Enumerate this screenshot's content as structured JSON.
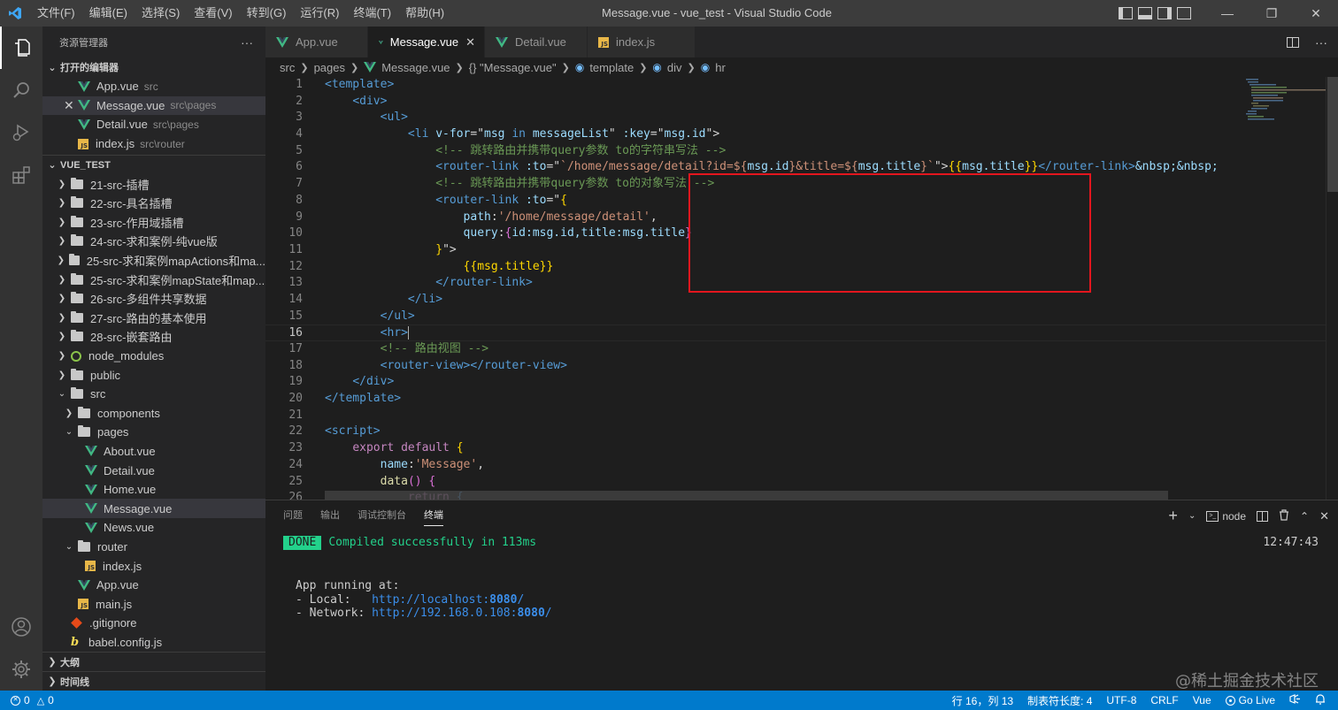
{
  "titlebar": {
    "menu": [
      "文件(F)",
      "编辑(E)",
      "选择(S)",
      "查看(V)",
      "转到(G)",
      "运行(R)",
      "终端(T)",
      "帮助(H)"
    ],
    "title": "Message.vue - vue_test - Visual Studio Code"
  },
  "sidebar": {
    "header": "资源管理器",
    "more": "···",
    "open_editors_title": "打开的编辑器",
    "open_editors": [
      {
        "name": "App.vue",
        "desc": "src",
        "icon": "vue"
      },
      {
        "name": "Message.vue",
        "desc": "src\\pages",
        "icon": "vue"
      },
      {
        "name": "Detail.vue",
        "desc": "src\\pages",
        "icon": "vue"
      },
      {
        "name": "index.js",
        "desc": "src\\router",
        "icon": "js"
      }
    ],
    "project_title": "VUE_TEST",
    "tree": [
      {
        "name": "21-src-插槽"
      },
      {
        "name": "22-src-具名插槽"
      },
      {
        "name": "23-src-作用域插槽"
      },
      {
        "name": "24-src-求和案例-纯vue版"
      },
      {
        "name": "25-src-求和案例mapActions和ma..."
      },
      {
        "name": "25-src-求和案例mapState和map..."
      },
      {
        "name": "26-src-多组件共享数据"
      },
      {
        "name": "27-src-路由的基本使用"
      },
      {
        "name": "28-src-嵌套路由"
      },
      {
        "name": "node_modules"
      },
      {
        "name": "public"
      },
      {
        "name": "src"
      },
      {
        "name": "components"
      },
      {
        "name": "pages"
      },
      {
        "name": "About.vue"
      },
      {
        "name": "Detail.vue"
      },
      {
        "name": "Home.vue"
      },
      {
        "name": "Message.vue"
      },
      {
        "name": "News.vue"
      },
      {
        "name": "router"
      },
      {
        "name": "index.js"
      },
      {
        "name": "App.vue"
      },
      {
        "name": "main.js"
      },
      {
        "name": ".gitignore"
      },
      {
        "name": "babel.config.js"
      }
    ],
    "outline_title": "大纲",
    "timeline_title": "时间线"
  },
  "tabs": [
    {
      "label": "App.vue"
    },
    {
      "label": "Message.vue"
    },
    {
      "label": "Detail.vue"
    },
    {
      "label": "index.js"
    }
  ],
  "breadcrumbs": [
    "src",
    "pages",
    "Message.vue",
    "{} \"Message.vue\"",
    "template",
    "div",
    "hr"
  ],
  "code": {
    "line_numbers": [
      "1",
      "2",
      "3",
      "4",
      "5",
      "6",
      "7",
      "8",
      "9",
      "10",
      "11",
      "12",
      "13",
      "14",
      "15",
      "16",
      "17",
      "18",
      "19",
      "20",
      "21",
      "22",
      "23",
      "24",
      "25",
      "26"
    ],
    "l1": "<template>",
    "l2": "<div>",
    "l3": "<ul>",
    "l4_a": "<li ",
    "l4_b": "v-for",
    "l4_c": "=\"",
    "l4_d": "msg",
    "l4_e": " in ",
    "l4_f": "messageList",
    "l4_g": "\" ",
    "l4_h": ":key",
    "l4_i": "=\"",
    "l4_j": "msg.id",
    "l4_k": "\">",
    "l5": "<!-- 跳转路由并携带query参数 to的字符串写法 -->",
    "l6_a": "<router-link ",
    "l6_b": ":to",
    "l6_c": "=\"",
    "l6_d": "`/home/message/detail?id=${",
    "l6_e": "msg.id",
    "l6_f": "}&title=${",
    "l6_g": "msg.title",
    "l6_h": "}`",
    "l6_i": "\">",
    "l6_j": "{{",
    "l6_k": "msg.title",
    "l6_l": "}}",
    "l6_m": "</router-link>",
    "l6_n": "&nbsp;&nbsp;",
    "l7": "<!-- 跳转路由并携带query参数 to的对象写法 -->",
    "l8_a": "<router-link ",
    "l8_b": ":to",
    "l8_c": "=\"",
    "l8_d": "{",
    "l9_a": "path",
    "l9_b": ":",
    "l9_c": "'/home/message/detail'",
    "l9_d": ",",
    "l10_a": "query",
    "l10_b": ":",
    "l10_c": "{",
    "l10_d": "id",
    "l10_e": ":msg.id,",
    "l10_f": "title",
    "l10_g": ":msg.title",
    "l10_h": "}",
    "l11_a": "}",
    "l11_b": "\">",
    "l12": "{{msg.title}}",
    "l13": "</router-link>",
    "l14": "</li>",
    "l15": "</ul>",
    "l16": "<hr>",
    "l17": "<!-- 路由视图 -->",
    "l18_a": "<router-view>",
    "l18_b": "</router-view>",
    "l19": "</div>",
    "l20": "</template>",
    "l22": "<script>",
    "l23_a": "export default",
    "l23_b": " {",
    "l24_a": "name",
    "l24_b": ":",
    "l24_c": "'Message'",
    "l24_d": ",",
    "l25_a": "data",
    "l25_b": "() {",
    "l26_a": "return",
    "l26_b": " {"
  },
  "panel": {
    "tabs": [
      "问题",
      "输出",
      "调试控制台",
      "终端"
    ],
    "active_tab": "终端",
    "terminal_select": "node",
    "done_badge": "DONE",
    "compiled": "Compiled successfully in 113ms",
    "time": "12:47:43",
    "app_running": "App running at:",
    "local_label": "- Local:   ",
    "local_url": "http://localhost:",
    "local_port": "8080",
    "local_tail": "/",
    "network_label": "- Network: ",
    "network_url": "http://192.168.0.108:",
    "network_port": "8080",
    "network_tail": "/"
  },
  "statusbar": {
    "errors": "0",
    "warnings": "0",
    "position": "行 16，列 13",
    "tab_size": "制表符长度: 4",
    "encoding": "UTF-8",
    "eol": "CRLF",
    "language": "Vue",
    "golive": "Go Live"
  },
  "watermark": "@稀土掘金技术社区",
  "colors": {
    "accent": "#007acc",
    "highlight_box": "#e3161e",
    "vue_green": "#41b883"
  }
}
